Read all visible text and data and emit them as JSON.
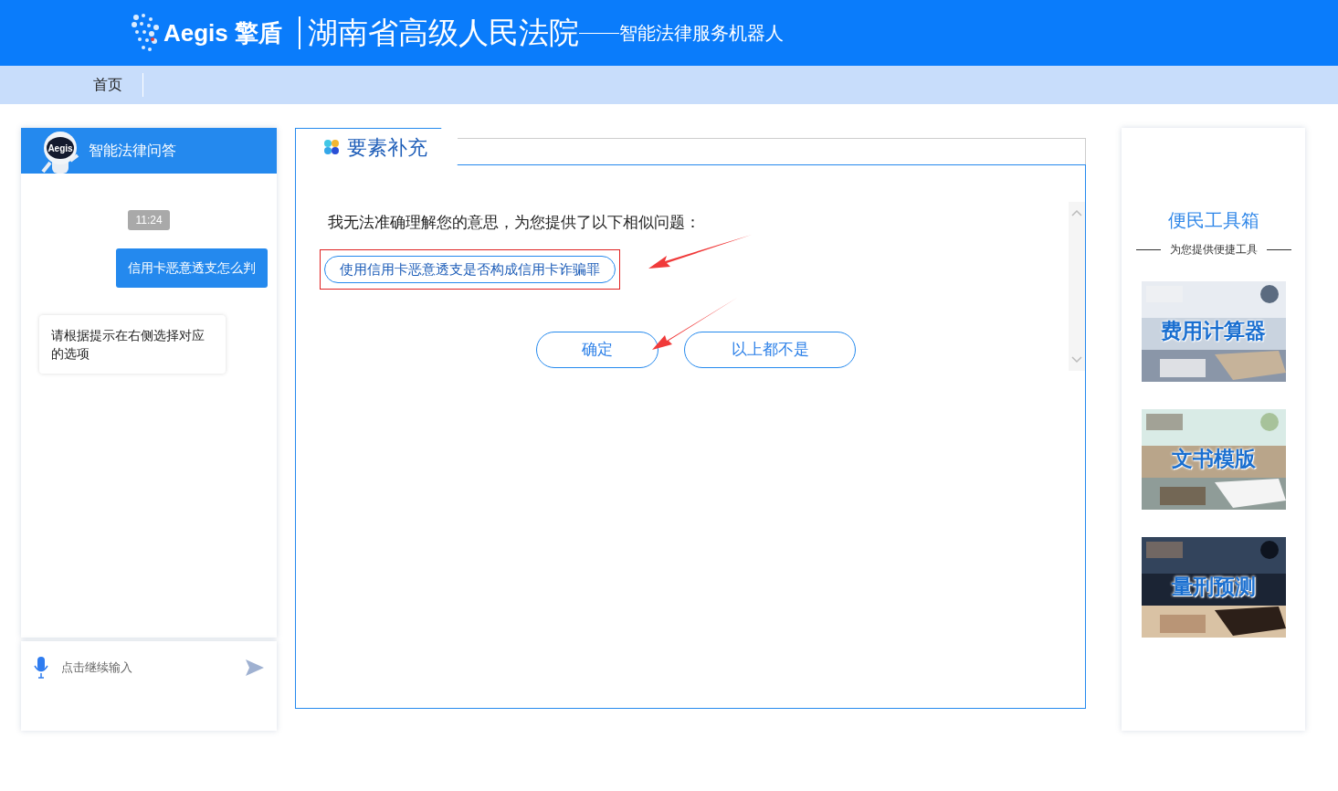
{
  "header": {
    "logo": "Aegis 擎盾",
    "title": "湖南省高级人民法院",
    "subtitle": "智能法律服务机器人"
  },
  "nav": {
    "items": [
      {
        "label": "首页",
        "selected": true
      }
    ]
  },
  "chat": {
    "title": "智能法律问答",
    "avatar_label": "Aegis",
    "messages": [
      {
        "kind": "time",
        "text": "11:24"
      },
      {
        "kind": "user",
        "text": "信用卡恶意透支怎么判"
      },
      {
        "kind": "bot",
        "text": "请根据提示在右侧选择对应的选项"
      }
    ],
    "input": {
      "placeholder": "点击继续输入"
    }
  },
  "panel": {
    "tab": "要素补充",
    "prompt": "我无法准确理解您的意思，为您提供了以下相似问题：",
    "options": [
      {
        "label": "使用信用卡恶意透支是否构成信用卡诈骗罪",
        "highlighted": true
      }
    ],
    "buttons": [
      "确定",
      "以上都不是"
    ]
  },
  "toolbox": {
    "title": "便民工具箱",
    "subtitle": "为您提供便捷工具",
    "tools": [
      {
        "label": "费用计算器",
        "kind": "picture"
      },
      {
        "label": "文书模版",
        "kind": "picture"
      },
      {
        "label": "量刑预测",
        "kind": "picture"
      }
    ]
  }
}
